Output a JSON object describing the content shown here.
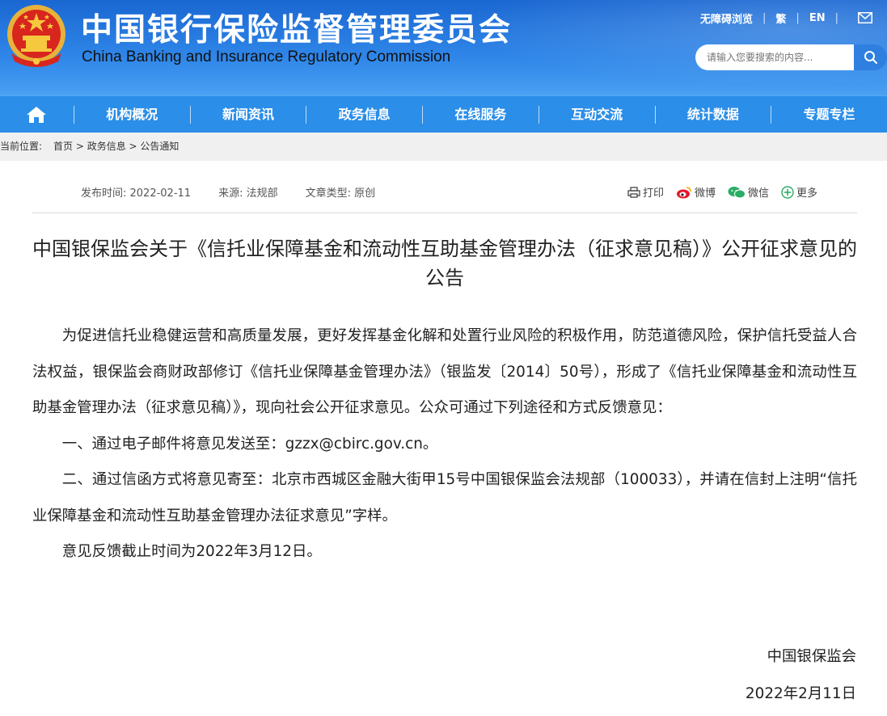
{
  "header": {
    "title_cn": "中国银行保险监督管理委员会",
    "title_en": "China Banking and Insurance Regulatory Commission",
    "links": [
      "无障碍浏览",
      "繁",
      "EN"
    ],
    "search_placeholder": "请输入您要搜索的内容..."
  },
  "nav": {
    "items": [
      "机构概况",
      "新闻资讯",
      "政务信息",
      "在线服务",
      "互动交流",
      "统计数据",
      "专题专栏"
    ]
  },
  "breadcrumb": {
    "label": "当前位置:",
    "path": "首页 > 政务信息 > 公告通知"
  },
  "meta": {
    "publish_time": "发布时间: 2022-02-11",
    "source": "来源: 法规部",
    "type": "文章类型: 原创"
  },
  "share": {
    "print": "打印",
    "weibo": "微博",
    "wechat": "微信",
    "more": "更多"
  },
  "article": {
    "title": "中国银保监会关于《信托业保障基金和流动性互助基金管理办法（征求意见稿）》公开征求意见的公告",
    "paragraphs": [
      "为促进信托业稳健运营和高质量发展，更好发挥基金化解和处置行业风险的积极作用，防范道德风险，保护信托受益人合法权益，银保监会商财政部修订《信托业保障基金管理办法》（银监发〔2014〕50号），形成了《信托业保障基金和流动性互助基金管理办法（征求意见稿）》，现向社会公开征求意见。公众可通过下列途径和方式反馈意见：",
      "一、通过电子邮件将意见发送至：gzzx@cbirc.gov.cn。",
      "二、通过信函方式将意见寄至：北京市西城区金融大街甲15号中国银保监会法规部（100033），并请在信封上注明“信托业保障基金和流动性互助基金管理办法征求意见”字样。",
      "意见反馈截止时间为2022年3月12日。"
    ],
    "signature": "中国银保监会",
    "date": "2022年2月11日"
  }
}
